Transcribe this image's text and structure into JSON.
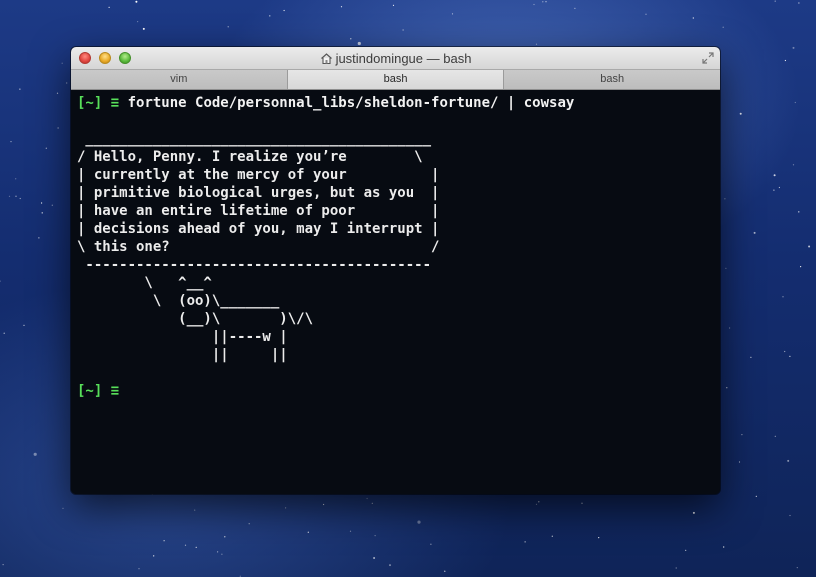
{
  "window": {
    "title": "justindomingue — bash"
  },
  "tabs": [
    {
      "label": "vim",
      "active": false
    },
    {
      "label": "bash",
      "active": true
    },
    {
      "label": "bash",
      "active": false
    }
  ],
  "terminal": {
    "prompt": "[~] ≡",
    "command": "fortune Code/personnal_libs/sheldon-fortune/ | cowsay",
    "output_lines": [
      "",
      " _________________________________________",
      "/ Hello, Penny. I realize you’re        \\",
      "| currently at the mercy of your          |",
      "| primitive biological urges, but as you  |",
      "| have an entire lifetime of poor         |",
      "| decisions ahead of you, may I interrupt |",
      "\\ this one?                               /",
      " -----------------------------------------",
      "        \\   ^__^",
      "         \\  (oo)\\_______",
      "            (__)\\       )\\/\\",
      "                ||----w |",
      "                ||     ||",
      ""
    ],
    "final_prompt": "[~] ≡"
  },
  "colors": {
    "prompt_green": "#58e05a",
    "terminal_bg": "#070b12",
    "text": "#ececec"
  }
}
